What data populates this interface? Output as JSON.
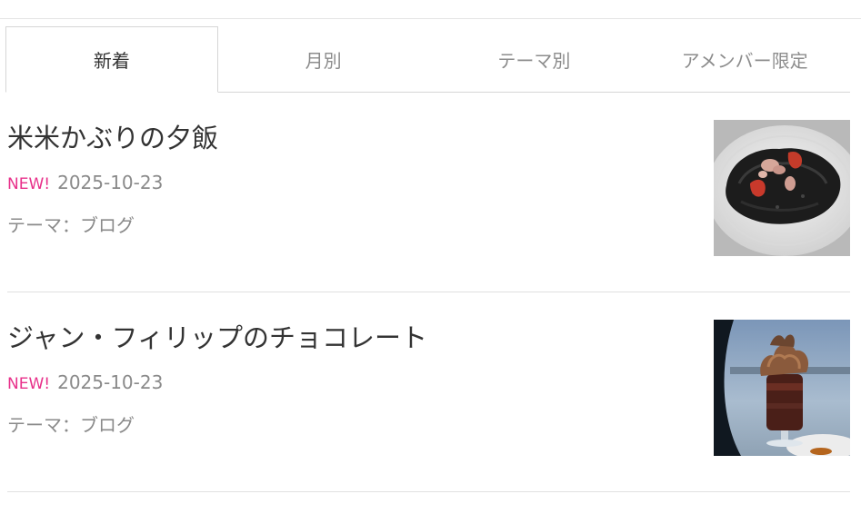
{
  "tabs": [
    {
      "label": "新着",
      "active": true
    },
    {
      "label": "月別",
      "active": false
    },
    {
      "label": "テーマ別",
      "active": false
    },
    {
      "label": "アメンバー限定",
      "active": false
    }
  ],
  "entries": [
    {
      "title": "米米かぶりの夕飯",
      "new_label": "NEW!",
      "date": "2025-10-23",
      "theme": "テーマ：ブログ",
      "thumbnail": "squid-ink-risotto-photo"
    },
    {
      "title": "ジャン・フィリップのチョコレート",
      "new_label": "NEW!",
      "date": "2025-10-23",
      "theme": "テーマ：ブログ",
      "thumbnail": "chocolate-parfait-photo"
    }
  ],
  "colors": {
    "new_badge": "#e8308a",
    "meta_text": "#8a8a8a",
    "title_text": "#333333",
    "divider": "#e0e0e0"
  }
}
